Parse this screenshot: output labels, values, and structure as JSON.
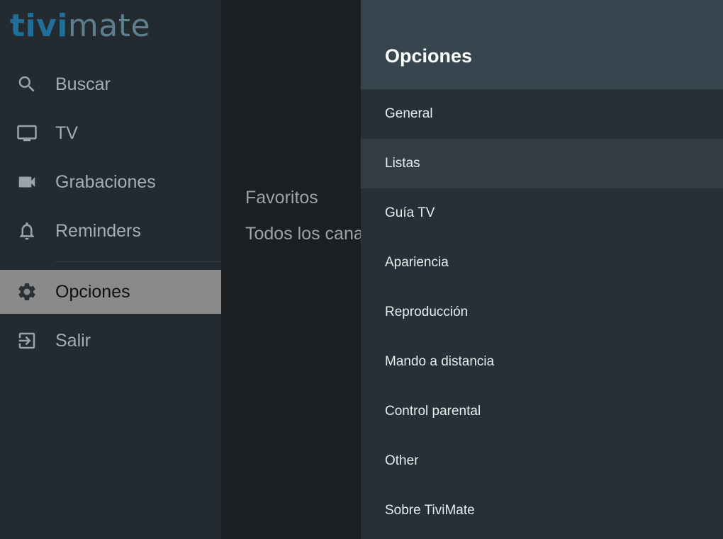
{
  "logo": {
    "part1": "tivi",
    "part2": "mate"
  },
  "nav": {
    "items": [
      {
        "label": "Buscar",
        "icon": "search-icon"
      },
      {
        "label": "TV",
        "icon": "tv-icon"
      },
      {
        "label": "Grabaciones",
        "icon": "video-camera-icon"
      },
      {
        "label": "Reminders",
        "icon": "bell-icon"
      },
      {
        "label": "Opciones",
        "icon": "gear-icon",
        "active": true
      },
      {
        "label": "Salir",
        "icon": "exit-icon"
      }
    ]
  },
  "groups": [
    "Favoritos",
    "Todos los canales"
  ],
  "options_panel": {
    "title": "Opciones",
    "items": [
      "General",
      "Listas",
      "Guía TV",
      "Apariencia",
      "Reproducción",
      "Mando a distancia",
      "Control parental",
      "Other",
      "Sobre TiviMate"
    ],
    "focused": "Listas"
  },
  "colors": {
    "rail_bg": "#232b31",
    "active_bg": "#8a8a8a",
    "panel_bg": "#263037",
    "panel_header_bg": "#37464e",
    "logo_accent": "#1f6f99"
  }
}
